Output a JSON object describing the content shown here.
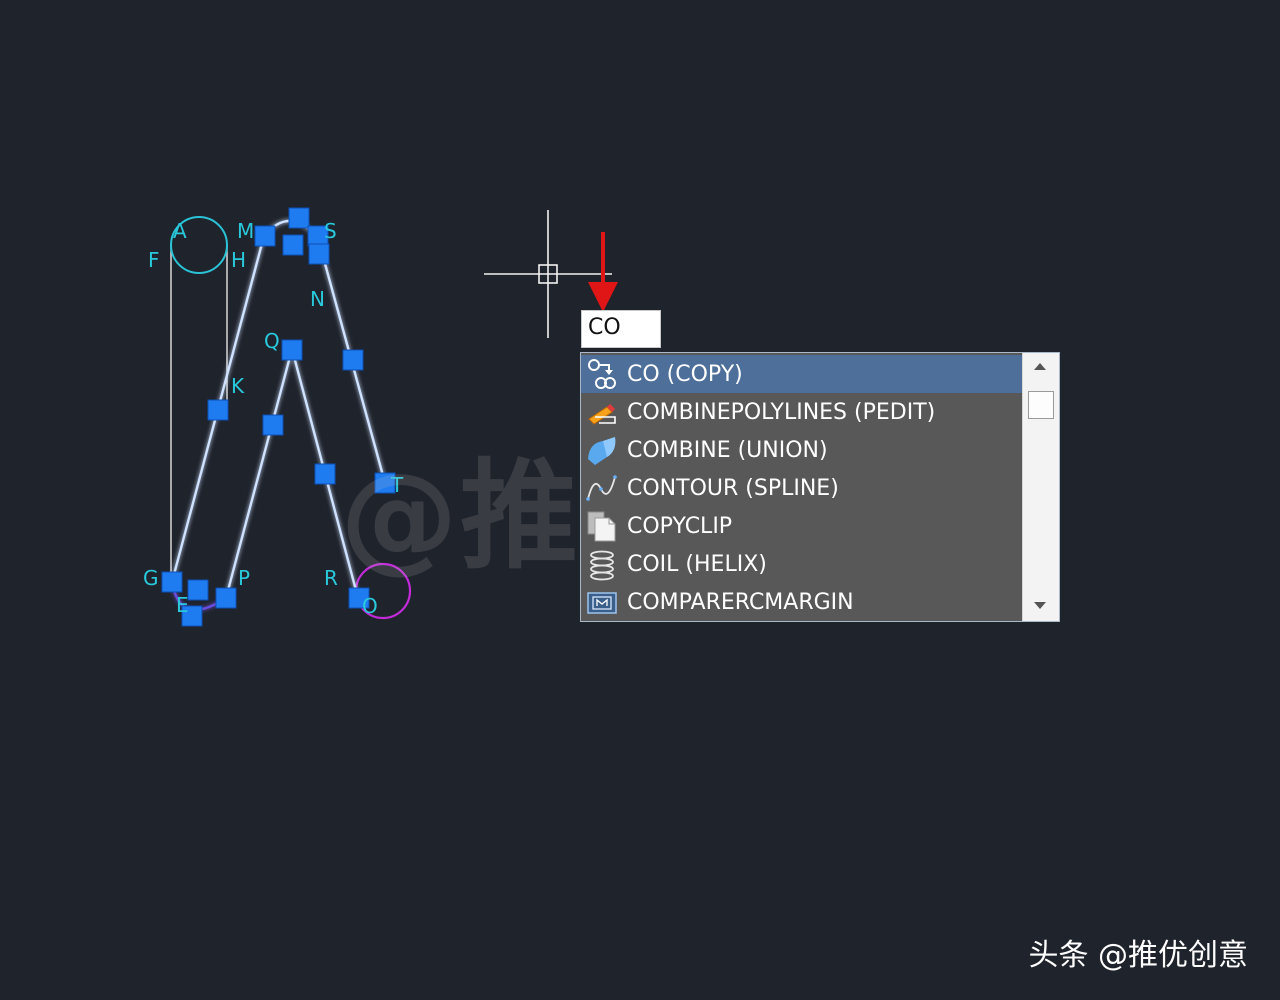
{
  "canvas": {
    "point_labels": [
      "A",
      "M",
      "S",
      "F",
      "H",
      "N",
      "Q",
      "K",
      "T",
      "G",
      "P",
      "R",
      "O",
      "E"
    ]
  },
  "command": {
    "input_value": "CO"
  },
  "autocomplete": {
    "items": [
      {
        "label": "CO (COPY)",
        "icon": "copy-icon",
        "selected": true
      },
      {
        "label": "COMBINEPOLYLINES (PEDIT)",
        "icon": "pencil-polyline-icon",
        "selected": false
      },
      {
        "label": "COMBINE (UNION)",
        "icon": "union-solid-icon",
        "selected": false
      },
      {
        "label": "CONTOUR (SPLINE)",
        "icon": "spline-icon",
        "selected": false
      },
      {
        "label": "COPYCLIP",
        "icon": "clipboard-page-icon",
        "selected": false
      },
      {
        "label": "COIL (HELIX)",
        "icon": "helix-icon",
        "selected": false
      },
      {
        "label": "COMPARERCMARGIN",
        "icon": "compare-margin-icon",
        "selected": false
      }
    ]
  },
  "watermark": {
    "text": "@推优创意"
  },
  "credit": {
    "text": "头条 @推优创意"
  },
  "colors": {
    "background": "#1f232c",
    "outline": "#cfe2ff",
    "grip": "#1f7cf0",
    "label": "#29c9db",
    "circle_a": "#2ac3d6",
    "circle_o": "#c22bd8",
    "arrow": "#e01515",
    "list_bg": "#585858",
    "list_selected": "#4d6f99"
  }
}
